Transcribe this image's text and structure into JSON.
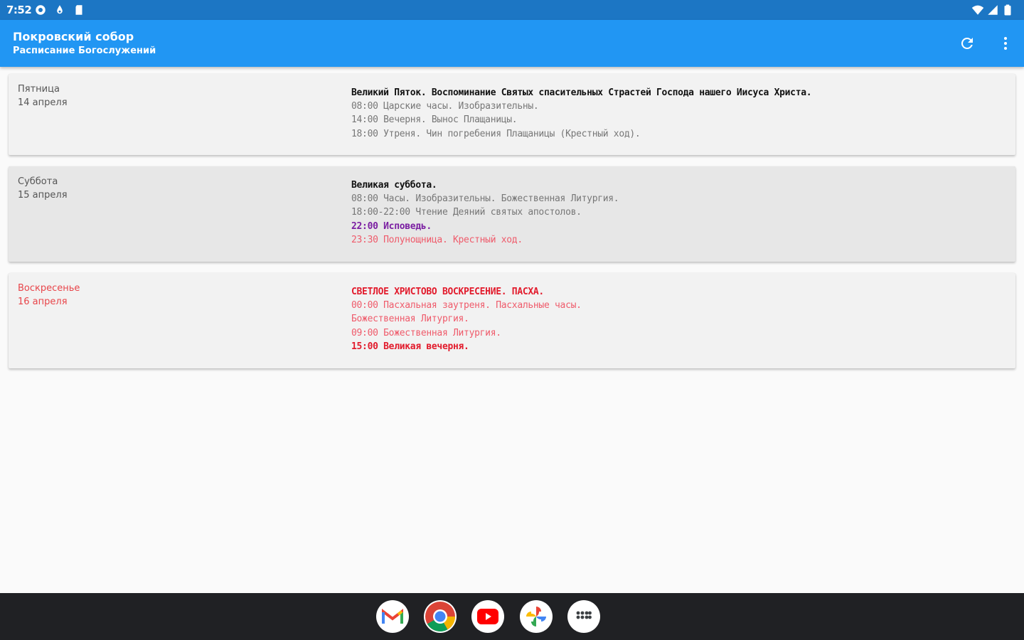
{
  "status_bar": {
    "time": "7:52",
    "left_icons": [
      "settings-icon",
      "vpn-key-icon",
      "sd-card-icon"
    ],
    "right_icons": [
      "wifi-icon",
      "signal-icon",
      "battery-icon"
    ]
  },
  "app_bar": {
    "title": "Покровский собор",
    "subtitle": "Расписание Богослужений",
    "actions": [
      "refresh-icon",
      "more-vert-icon"
    ]
  },
  "colors": {
    "status_bar": "#1c76c4",
    "app_bar": "#2196f3",
    "purple": "#7b1fa2",
    "red": "#e21b2c"
  },
  "days": [
    {
      "weekday": "Пятница",
      "date": "14 апреля",
      "lines": [
        "Великий Пяток. Воспоминание Святых спасительных Страстей Господа нашего Иисуса Христа.",
        "08:00 Царские часы. Изобразительны.",
        "14:00 Вечерня. Вынос Плащаницы.",
        "18:00 Утреня. Чин погребения Плащаницы (Крестный ход)."
      ]
    },
    {
      "weekday": "Суббота",
      "date": "15 апреля",
      "lines": [
        "Великая суббота.",
        "08:00 Часы. Изобразительны. Божественная Литургия.",
        "18:00-22:00 Чтение Деяний святых апостолов.",
        "22:00 Исповедь.",
        "23:30 Полунощница. Крестный ход."
      ]
    },
    {
      "weekday": "Воскресенье",
      "date": "16 апреля",
      "lines": [
        "СВЕТЛОЕ ХРИСТОВО ВОСКРЕСЕНИЕ. ПАСХА.",
        "00:00 Пасхальная заутреня. Пасхальные часы.",
        "Божественная Литургия.",
        "09:00 Божественная Литургия.",
        "15:00 Великая вечерня."
      ]
    }
  ],
  "dock": {
    "apps": [
      "gmail-icon",
      "chrome-icon",
      "youtube-icon",
      "photos-icon",
      "app-drawer-icon"
    ]
  }
}
